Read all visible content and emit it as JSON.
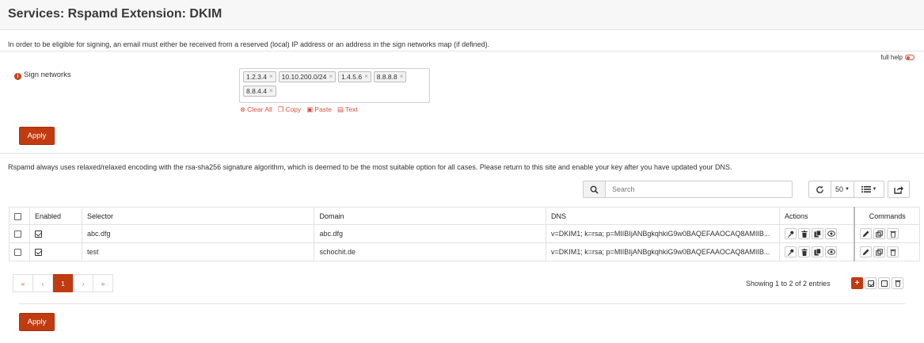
{
  "page": {
    "title": "Services: Rspamd Extension: DKIM",
    "intro": "In order to be eligible for signing, an email must either be received from a reserved (local) IP address or an address in the sign networks map (if defined).",
    "full_help": "full help"
  },
  "sign_networks": {
    "label": "Sign networks",
    "tags": [
      "1.2.3.4",
      "10.10.200.0/24",
      "1.4.5.6",
      "8.8.8.8",
      "8.8.4.4"
    ],
    "tools": {
      "clear_all": "Clear All",
      "copy": "Copy",
      "paste": "Paste",
      "text": "Text"
    }
  },
  "apply_label": "Apply",
  "rspamd_note": "Rspamd always uses relaxed/relaxed encoding with the rsa-sha256 signature algorithm, which is deemed to be the most suitable option for all cases. Please return to this site and enable your key after you have updated your DNS.",
  "search": {
    "placeholder": "Search"
  },
  "page_size": "50",
  "table": {
    "headers": {
      "enabled": "Enabled",
      "selector": "Selector",
      "domain": "Domain",
      "dns": "DNS",
      "actions": "Actions",
      "commands": "Commands"
    },
    "rows": [
      {
        "enabled": true,
        "selector": "abc.dfg",
        "domain": "abc.dfg",
        "dns": "v=DKIM1; k=rsa; p=MIIBIjANBgkqhkiG9w0BAQEFAAOCAQ8AMIIB..."
      },
      {
        "enabled": true,
        "selector": "test",
        "domain": "schochit.de",
        "dns": "v=DKIM1; k=rsa; p=MIIBIjANBgkqhkiG9w0BAQEFAAOCAQ8AMIIB..."
      }
    ]
  },
  "pagination": {
    "first": "«",
    "prev": "‹",
    "current": "1",
    "next": "›",
    "last": "»"
  },
  "showing": "Showing 1 to 2 of 2 entries",
  "bulk": {
    "add": "+"
  },
  "colors": {
    "accent": "#c03b10",
    "link": "#d94f3d"
  }
}
